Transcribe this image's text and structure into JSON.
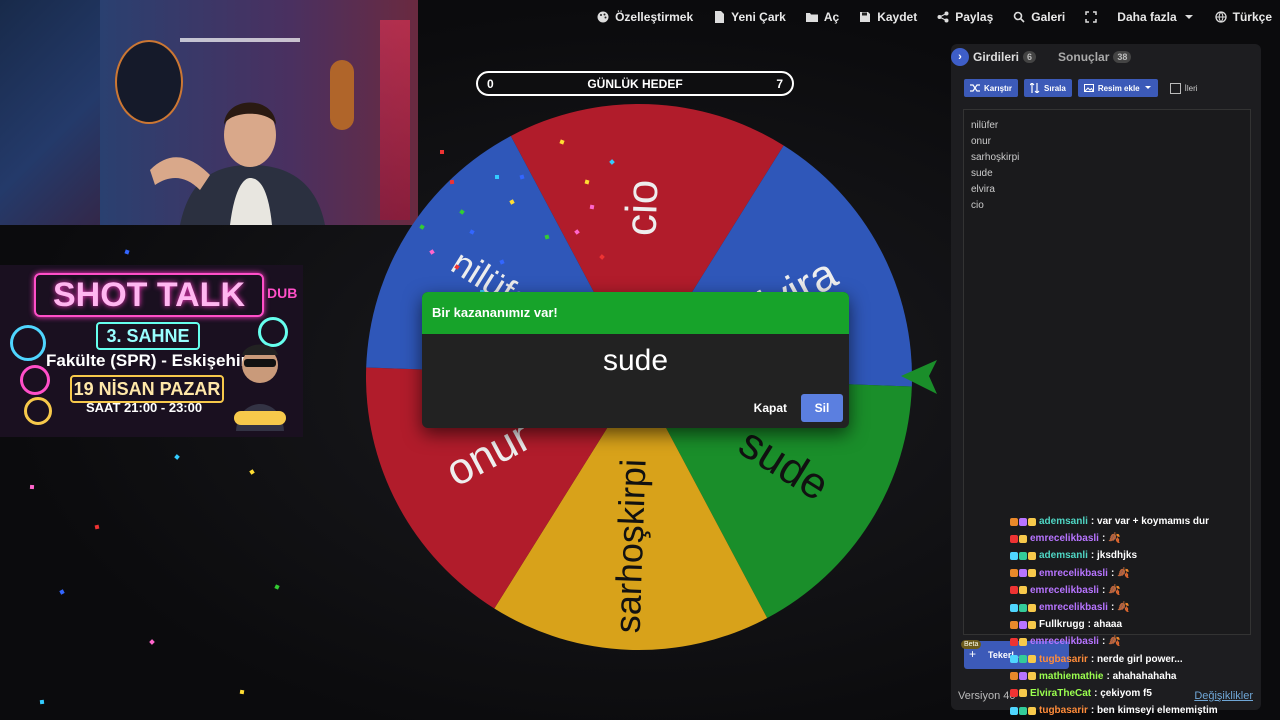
{
  "toolbar": {
    "items": [
      {
        "label": "Özelleştirmek",
        "icon": "palette-icon"
      },
      {
        "label": "Yeni Çark",
        "icon": "document-icon"
      },
      {
        "label": "Aç",
        "icon": "folder-icon"
      },
      {
        "label": "Kaydet",
        "icon": "save-icon"
      },
      {
        "label": "Paylaş",
        "icon": "share-icon"
      },
      {
        "label": "Galeri",
        "icon": "search-icon"
      },
      {
        "label": "",
        "icon": "fullscreen-icon"
      },
      {
        "label": "Daha fazla",
        "icon": "chevron-down-icon"
      },
      {
        "label": "Türkçe",
        "icon": "globe-icon"
      }
    ]
  },
  "goal": {
    "left_value": "0",
    "title": "GÜNLÜK HEDEF",
    "right_value": "7"
  },
  "wheel": {
    "segments": [
      {
        "label": "cio",
        "color": "#b11c2b"
      },
      {
        "label": "elvira",
        "color": "#2f57b9"
      },
      {
        "label": "sude",
        "color": "#1a8e2a"
      },
      {
        "label": "sarhoşkirpi",
        "color": "#d8a21a"
      },
      {
        "label": "onur",
        "color": "#b11c2b"
      },
      {
        "label": "nilüfer",
        "color": "#2f57b9"
      }
    ],
    "pointer_color": "#1a8e2a"
  },
  "dialog": {
    "title": "Bir kazananımız var!",
    "winner": "sude",
    "close_label": "Kapat",
    "remove_label": "Sil"
  },
  "panel": {
    "tab_entries": "Girdileri",
    "tab_entries_count": "6",
    "tab_results": "Sonuçlar",
    "tab_results_count": "38",
    "shuffle_label": "Karıştır",
    "sort_label": "Sırala",
    "add_image_label": "Resim ekle",
    "advanced_label": "İleri",
    "entries": [
      "nilüfer",
      "onur",
      "sarhoşkirpi",
      "sude",
      "elvira",
      "cio"
    ],
    "beta_tag": "Beta",
    "beta_button": "Tekerl...",
    "version": "Versiyon 40",
    "changes_link": "Değişiklikler"
  },
  "poster": {
    "title": "SHOT TALK",
    "dub": "DUB",
    "stage": "3. SAHNE",
    "venue": "Fakülte (SPR) - Eskişehir",
    "date": "19 NİSAN PAZAR",
    "time": "SAAT 21:00 - 23:00"
  },
  "chat": [
    {
      "user": "ademsanli",
      "color": "#4fd6c4",
      "text": "var var + koymamıs dur"
    },
    {
      "user": "emrecelikbasli",
      "color": "#b774ff",
      "text": "🍂"
    },
    {
      "user": "ademsanli",
      "color": "#4fd6c4",
      "text": "jksdhjks"
    },
    {
      "user": "emrecelikbasli",
      "color": "#b774ff",
      "text": "🍂"
    },
    {
      "user": "emrecelikbasli",
      "color": "#b774ff",
      "text": "🍂"
    },
    {
      "user": "emrecelikbasli",
      "color": "#b774ff",
      "text": "🍂"
    },
    {
      "user": "Fullkrugg",
      "color": "#ffffff",
      "text": "ahaaa"
    },
    {
      "user": "emrecelikbasli",
      "color": "#b774ff",
      "text": "🍂"
    },
    {
      "user": "tugbasarir",
      "color": "#ff8c3a",
      "text": "nerde girl power..."
    },
    {
      "user": "mathiemathie",
      "color": "#9bff4f",
      "text": "ahahahahaha"
    },
    {
      "user": "ElviraTheCat",
      "color": "#9bff4f",
      "text": "çekiyom f5"
    },
    {
      "user": "tugbasarir",
      "color": "#ff8c3a",
      "text": "ben kimseyi elememiştim"
    }
  ]
}
